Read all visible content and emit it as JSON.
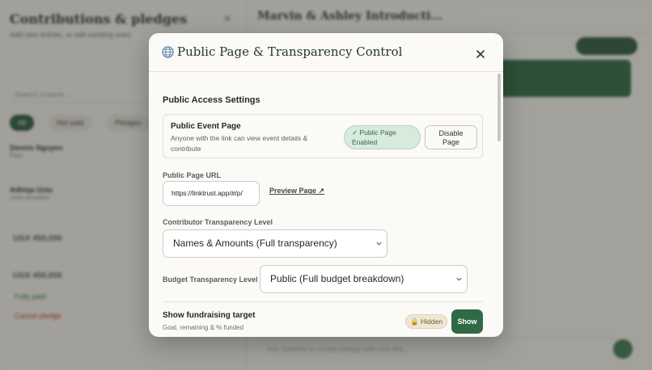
{
  "background": {
    "sidebar_title": "Contributions & pledges",
    "sidebar_subtitle": "Add new entries, or edit existing ones",
    "search_placeholder": "Search a name...",
    "chip_all": "All",
    "chip_not_paid": "Not paid",
    "chip_pledges": "Pledges",
    "row1_name": "Dennis Nguyen",
    "row1_sub": "Paid",
    "row2_name": "Adhiqa Ustu",
    "row2_sub": "cash donation",
    "amount1": "UGX 450,000",
    "amount2": "UGX 450,000",
    "green_text": "Fully paid",
    "red_text": "Cancel pledge",
    "event_title": "Marvin & Ashley Introducti...",
    "chat_placeholder": "Ask Satellite to create pledge with one like..."
  },
  "modal": {
    "title": "Public Page & Transparency Control",
    "section_title": "Public Access Settings",
    "public_page": {
      "title": "Public Event Page",
      "description": "Anyone with the link can view event details & contribute",
      "status_line1": "✓ Public Page",
      "status_line2": "Enabled",
      "disable_line1": "Disable",
      "disable_line2": "Page"
    },
    "url_label": "Public Page URL",
    "url_value": "https://linktrust.app/#/p/",
    "preview_label": "Preview Page ↗",
    "contributor_label": "Contributor Transparency Level",
    "contributor_value": "Names & Amounts (Full transparency)",
    "budget_label": "Budget Transparency Level",
    "budget_value": "Public (Full budget breakdown)",
    "fundraising": {
      "title": "Show fundraising target",
      "subtitle": "Goal, remaining & % funded",
      "badge": "🔒 Hidden",
      "button": "Show"
    }
  },
  "colors": {
    "accent_green": "#2f6a45",
    "enabled_bg": "#d8eadc",
    "hidden_bg": "#f0e6d4"
  },
  "icons": [
    "globe-icon",
    "close-icon",
    "chevron-down-icon",
    "lock-icon"
  ]
}
